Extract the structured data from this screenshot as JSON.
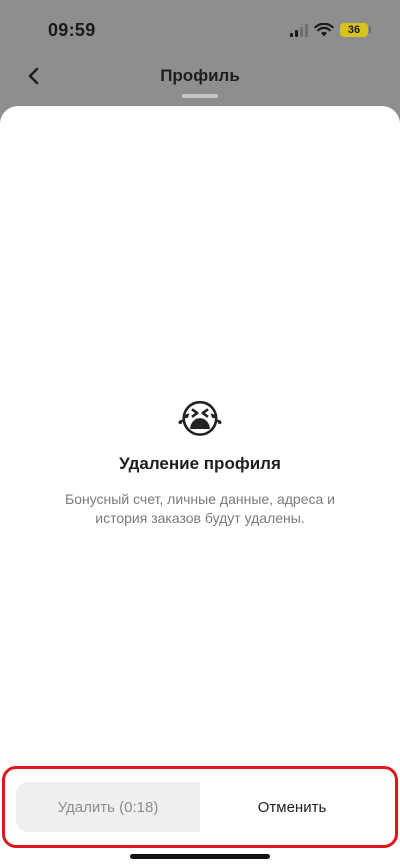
{
  "status_bar": {
    "time": "09:59",
    "battery_level": "36",
    "icons": [
      "signal-icon",
      "wifi-icon",
      "battery-icon"
    ]
  },
  "nav": {
    "title": "Профиль",
    "back_icon": "chevron-left-icon"
  },
  "sheet": {
    "emoji": "😭",
    "title": "Удаление профиля",
    "description": "Бонусный счет, личные данные, адреса и история заказов будут удалены.",
    "delete_label": "Удалить (0:18)",
    "cancel_label": "Отменить"
  },
  "colors": {
    "highlight_border": "#e0161d",
    "battery": "#d8c31a"
  }
}
